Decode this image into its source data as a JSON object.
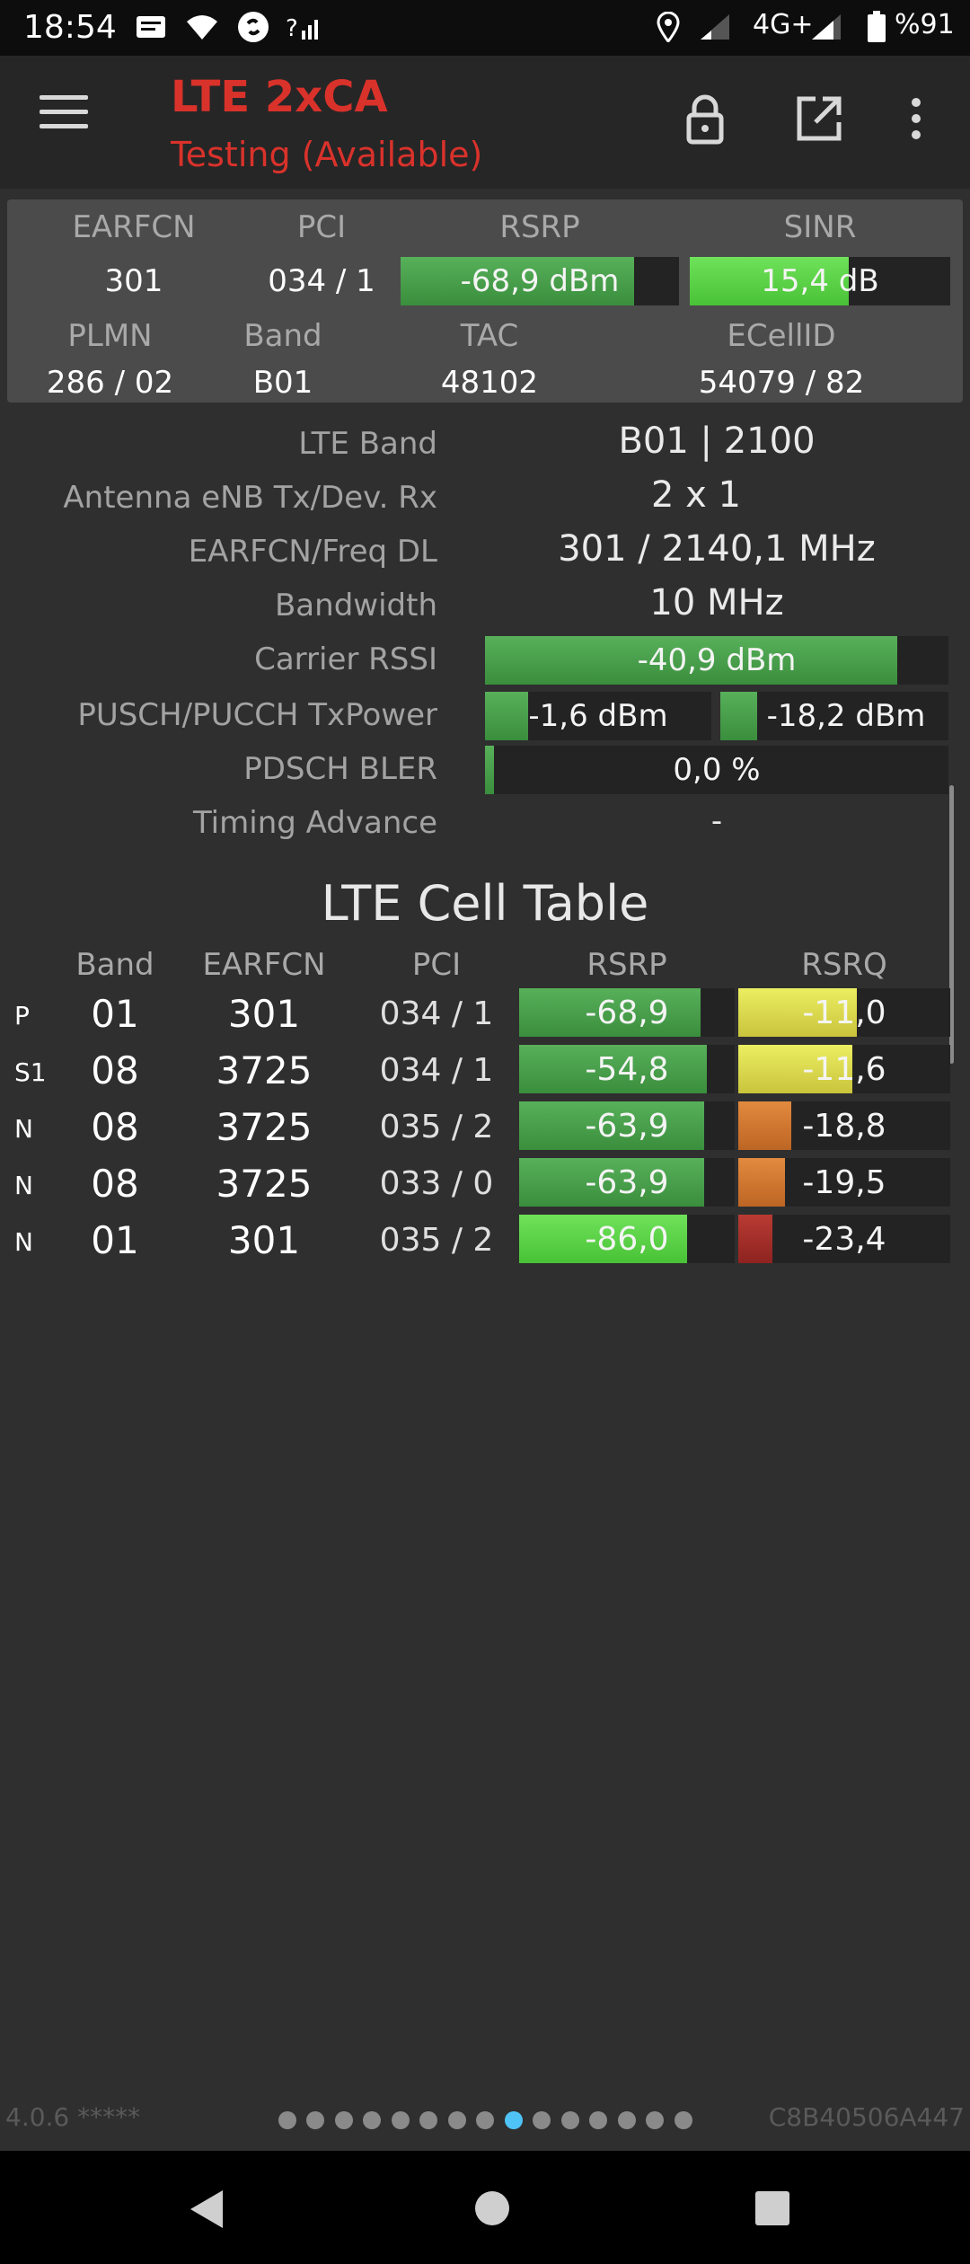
{
  "status_bar": {
    "time": "18:54",
    "network": "4G+",
    "battery": "%91",
    "icons": [
      "message-icon",
      "wifi-icon",
      "shazam-icon",
      "signal-question-icon",
      "location-icon",
      "signal-weak-icon",
      "signal-icon",
      "battery-icon"
    ]
  },
  "app_bar": {
    "title": "LTE 2xCA",
    "subtitle": "Testing (Available)",
    "title_color": "#d9322b"
  },
  "summary": {
    "headers": {
      "earfcn": "EARFCN",
      "pci": "PCI",
      "rsrp": "RSRP",
      "sinr": "SINR",
      "plmn": "PLMN",
      "band": "Band",
      "tac": "TAC",
      "ecellid": "ECellID"
    },
    "earfcn": "301",
    "pci": "034 / 1",
    "rsrp": "-68,9 dBm",
    "rsrp_fill": 0.84,
    "sinr": "15,4 dB",
    "sinr_fill": 0.61,
    "plmn": "286 / 02",
    "band": "B01",
    "tac": "48102",
    "ecellid": "54079 / 82"
  },
  "details": {
    "lte_band_label": "LTE Band",
    "lte_band_value": "B01 | 2100",
    "antenna_label": "Antenna eNB Tx/Dev. Rx",
    "antenna_value": "2 x 1",
    "earfcn_freq_label": "EARFCN/Freq DL",
    "earfcn_freq_value": "301 / 2140,1 MHz",
    "bandwidth_label": "Bandwidth",
    "bandwidth_value": "10 MHz",
    "rssi_label": "Carrier RSSI",
    "rssi_value": "-40,9 dBm",
    "rssi_fill": 0.89,
    "txpower_label": "PUSCH/PUCCH TxPower",
    "pusch_value": "-1,6 dBm",
    "pusch_fill": 0.19,
    "pucch_value": "-18,2 dBm",
    "pucch_fill": 0.16,
    "bler_label": "PDSCH BLER",
    "bler_value": "0,0 %",
    "bler_fill": 0.02,
    "ta_label": "Timing Advance",
    "ta_value": "-"
  },
  "cell_table": {
    "title": "LTE Cell Table",
    "columns": [
      "Band",
      "EARFCN",
      "PCI",
      "RSRP",
      "RSRQ"
    ],
    "rows": [
      {
        "tag": "P",
        "band": "01",
        "earfcn": "301",
        "pci": "034 / 1",
        "rsrp": "-68,9",
        "rsrp_fill": 0.84,
        "rsrq": "-11,0",
        "rsrq_fill": 0.56
      },
      {
        "tag": "S1",
        "band": "08",
        "earfcn": "3725",
        "pci": "034 / 1",
        "rsrp": "-54,8",
        "rsrp_fill": 0.87,
        "rsrq": "-11,6",
        "rsrq_fill": 0.54
      },
      {
        "tag": "N",
        "band": "08",
        "earfcn": "3725",
        "pci": "035 / 2",
        "rsrp": "-63,9",
        "rsrp_fill": 0.86,
        "rsrq": "-18,8",
        "rsrq_fill": 0.25
      },
      {
        "tag": "N",
        "band": "08",
        "earfcn": "3725",
        "pci": "033 / 0",
        "rsrp": "-63,9",
        "rsrp_fill": 0.86,
        "rsrq": "-19,5",
        "rsrq_fill": 0.22
      },
      {
        "tag": "N",
        "band": "01",
        "earfcn": "301",
        "pci": "035 / 2",
        "rsrp": "-86,0",
        "rsrp_fill": 0.78,
        "rsrq": "-23,4",
        "rsrq_fill": 0.16
      }
    ]
  },
  "footer": {
    "version": "4.0.6 *****",
    "device_id": "C8B40506A447",
    "pages": 15,
    "active_page": 8
  }
}
